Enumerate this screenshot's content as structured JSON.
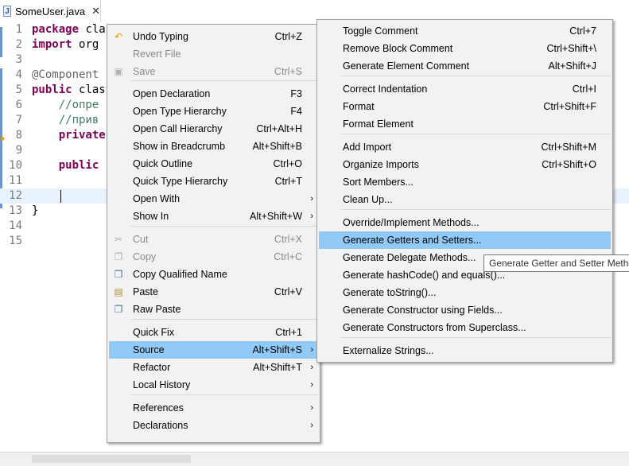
{
  "tab": {
    "title": "SomeUser.java",
    "close": "✕",
    "icon": "J"
  },
  "editor": {
    "lines": [
      {
        "n": "1",
        "kw": "package ",
        "rest": "cla"
      },
      {
        "n": "2",
        "kw": "import ",
        "rest": "org"
      },
      {
        "n": "3",
        "kw": "",
        "rest": ""
      },
      {
        "n": "4",
        "ann": "@Component"
      },
      {
        "n": "5",
        "kw": "public ",
        "rest": "clas"
      },
      {
        "n": "6",
        "cm": "    //опре"
      },
      {
        "n": "7",
        "cm": "    //прив"
      },
      {
        "n": "8",
        "kw2": "    private"
      },
      {
        "n": "9",
        "kw": "",
        "rest": ""
      },
      {
        "n": "10",
        "kw2": "    public"
      },
      {
        "n": "11",
        "kw": "",
        "rest": ""
      },
      {
        "n": "12",
        "kw": "",
        "rest": ""
      },
      {
        "n": "13",
        "rest2": "}"
      },
      {
        "n": "14",
        "kw": "",
        "rest": ""
      },
      {
        "n": "15",
        "kw": "",
        "rest": ""
      }
    ]
  },
  "context_menu": {
    "items": [
      {
        "label": "Undo Typing",
        "shortcut": "Ctrl+Z",
        "icon": "undo-icon"
      },
      {
        "label": "Revert File",
        "shortcut": "",
        "disabled": true
      },
      {
        "label": "Save",
        "shortcut": "Ctrl+S",
        "disabled": true,
        "icon": "save-icon"
      },
      {
        "label": "Open Declaration",
        "shortcut": "F3"
      },
      {
        "label": "Open Type Hierarchy",
        "shortcut": "F4"
      },
      {
        "label": "Open Call Hierarchy",
        "shortcut": "Ctrl+Alt+H"
      },
      {
        "label": "Show in Breadcrumb",
        "shortcut": "Alt+Shift+B"
      },
      {
        "label": "Quick Outline",
        "shortcut": "Ctrl+O"
      },
      {
        "label": "Quick Type Hierarchy",
        "shortcut": "Ctrl+T"
      },
      {
        "label": "Open With",
        "shortcut": "",
        "submenu": true
      },
      {
        "label": "Show In",
        "shortcut": "Alt+Shift+W",
        "submenu": true
      },
      {
        "label": "Cut",
        "shortcut": "Ctrl+X",
        "disabled": true,
        "icon": "cut-icon"
      },
      {
        "label": "Copy",
        "shortcut": "Ctrl+C",
        "disabled": true,
        "icon": "copy-icon"
      },
      {
        "label": "Copy Qualified Name",
        "shortcut": "",
        "icon": "copy-qualified-icon"
      },
      {
        "label": "Paste",
        "shortcut": "Ctrl+V",
        "icon": "paste-icon"
      },
      {
        "label": "Raw Paste",
        "shortcut": "",
        "icon": "raw-paste-icon"
      },
      {
        "label": "Quick Fix",
        "shortcut": "Ctrl+1"
      },
      {
        "label": "Source",
        "shortcut": "Alt+Shift+S",
        "submenu": true,
        "selected": true
      },
      {
        "label": "Refactor",
        "shortcut": "Alt+Shift+T",
        "submenu": true
      },
      {
        "label": "Local History",
        "shortcut": "",
        "submenu": true
      },
      {
        "label": "References",
        "shortcut": "",
        "submenu": true
      },
      {
        "label": "Declarations",
        "shortcut": "",
        "submenu": true
      }
    ]
  },
  "source_menu": {
    "items": [
      {
        "label": "Toggle Comment",
        "shortcut": "Ctrl+7"
      },
      {
        "label": "Remove Block Comment",
        "shortcut": "Ctrl+Shift+\\"
      },
      {
        "label": "Generate Element Comment",
        "shortcut": "Alt+Shift+J"
      },
      {
        "label": "Correct Indentation",
        "shortcut": "Ctrl+I"
      },
      {
        "label": "Format",
        "shortcut": "Ctrl+Shift+F"
      },
      {
        "label": "Format Element",
        "shortcut": ""
      },
      {
        "label": "Add Import",
        "shortcut": "Ctrl+Shift+M"
      },
      {
        "label": "Organize Imports",
        "shortcut": "Ctrl+Shift+O"
      },
      {
        "label": "Sort Members...",
        "shortcut": ""
      },
      {
        "label": "Clean Up...",
        "shortcut": ""
      },
      {
        "label": "Override/Implement Methods...",
        "shortcut": ""
      },
      {
        "label": "Generate Getters and Setters...",
        "shortcut": "",
        "selected": true
      },
      {
        "label": "Generate Delegate Methods...",
        "shortcut": ""
      },
      {
        "label": "Generate hashCode() and equals()...",
        "shortcut": ""
      },
      {
        "label": "Generate toString()...",
        "shortcut": ""
      },
      {
        "label": "Generate Constructor using Fields...",
        "shortcut": ""
      },
      {
        "label": "Generate Constructors from Superclass...",
        "shortcut": ""
      },
      {
        "label": "Externalize Strings...",
        "shortcut": ""
      }
    ]
  },
  "tooltip": {
    "text": "Generate Getter and Setter Methods"
  },
  "submenu_arrow": "›"
}
